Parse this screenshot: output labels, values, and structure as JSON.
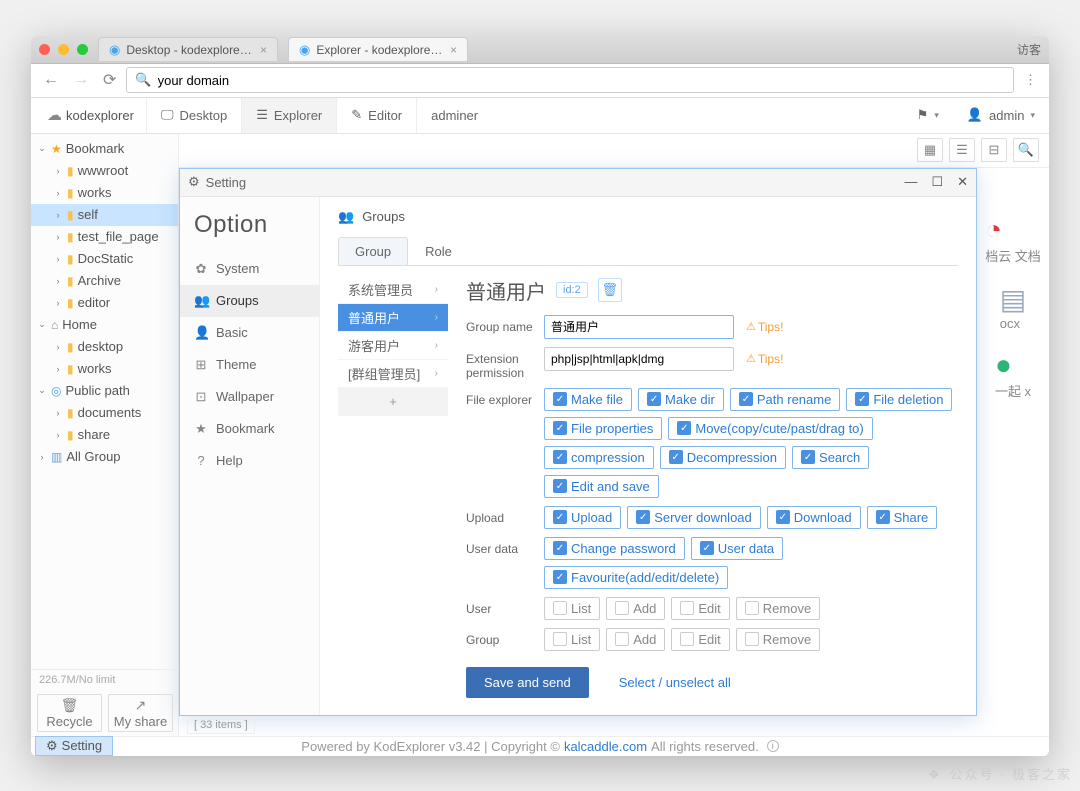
{
  "browser": {
    "tabs": [
      {
        "label": "Desktop - kodexplorer - Powe"
      },
      {
        "label": "Explorer - kodexplorer - Powe"
      }
    ],
    "guest": "访客",
    "address": "your domain"
  },
  "toolbar": {
    "brand": "kodexplorer",
    "tabs": [
      {
        "label": "Desktop"
      },
      {
        "label": "Explorer"
      },
      {
        "label": "Editor"
      },
      {
        "label": "adminer"
      }
    ],
    "user": "admin"
  },
  "tree": {
    "sections": [
      {
        "title": "Bookmark",
        "icon": "star",
        "open": true,
        "items": [
          {
            "label": "wwwroot"
          },
          {
            "label": "works"
          },
          {
            "label": "self",
            "selected": true
          },
          {
            "label": "test_file_page"
          },
          {
            "label": "DocStatic"
          },
          {
            "label": "Archive"
          },
          {
            "label": "editor"
          }
        ]
      },
      {
        "title": "Home",
        "icon": "home",
        "open": true,
        "items": [
          {
            "label": "desktop"
          },
          {
            "label": "works"
          }
        ]
      },
      {
        "title": "Public path",
        "icon": "pub",
        "open": true,
        "items": [
          {
            "label": "documents"
          },
          {
            "label": "share"
          }
        ]
      },
      {
        "title": "All Group",
        "icon": "grp",
        "open": false,
        "items": []
      }
    ],
    "quota": "226.7M/No limit",
    "recycle": "Recycle",
    "share": "My share"
  },
  "status": {
    "items": "33 items"
  },
  "dialog": {
    "title": "Setting",
    "option_heading": "Option",
    "options": [
      {
        "label": "System",
        "icon": "✿"
      },
      {
        "label": "Groups",
        "icon": "👥",
        "active": true
      },
      {
        "label": "Basic",
        "icon": "👤"
      },
      {
        "label": "Theme",
        "icon": "⊞"
      },
      {
        "label": "Wallpaper",
        "icon": "⊡"
      },
      {
        "label": "Bookmark",
        "icon": "★"
      },
      {
        "label": "Help",
        "icon": "?"
      }
    ],
    "pane": {
      "heading": "Groups",
      "tabs": [
        {
          "label": "Group",
          "active": true
        },
        {
          "label": "Role"
        }
      ],
      "sublist": [
        {
          "label": "系统管理员"
        },
        {
          "label": "普通用户",
          "active": true
        },
        {
          "label": "游客用户"
        },
        {
          "label": "[群组管理员]"
        }
      ],
      "form": {
        "title": "普通用户",
        "id_tag": "id:2",
        "rows": {
          "group_name": {
            "label": "Group name",
            "value": "普通用户",
            "tip": "Tips!"
          },
          "extension": {
            "label": "Extension permission",
            "value": "php|jsp|html|apk|dmg",
            "tip": "Tips!"
          },
          "file_explorer": {
            "label": "File explorer",
            "checks": [
              "Make file",
              "Make dir",
              "Path rename",
              "File deletion",
              "File properties",
              "Move(copy/cute/past/drag to)",
              "compression",
              "Decompression",
              "Search",
              "Edit and save"
            ]
          },
          "upload": {
            "label": "Upload",
            "checks": [
              "Upload",
              "Server download",
              "Download",
              "Share"
            ]
          },
          "user_data": {
            "label": "User data",
            "checks": [
              "Change password",
              "User data",
              "Favourite(add/edit/delete)"
            ]
          },
          "user": {
            "label": "User",
            "unchecks": [
              "List",
              "Add",
              "Edit",
              "Remove"
            ]
          },
          "group": {
            "label": "Group",
            "unchecks": [
              "List",
              "Add",
              "Edit",
              "Remove"
            ]
          }
        },
        "save": "Save and send",
        "select": "Select / unselect all"
      }
    }
  },
  "right_hints": [
    {
      "text": "档云\n文档"
    },
    {
      "text": "ocx"
    },
    {
      "text": "一起\nx"
    }
  ],
  "footer": {
    "powered": "Powered by KodExplorer v3.42 | Copyright © ",
    "link": "kalcaddle.com",
    "rights": " All rights reserved."
  },
  "task": "Setting",
  "watermark": "公众号 · 极客之家"
}
